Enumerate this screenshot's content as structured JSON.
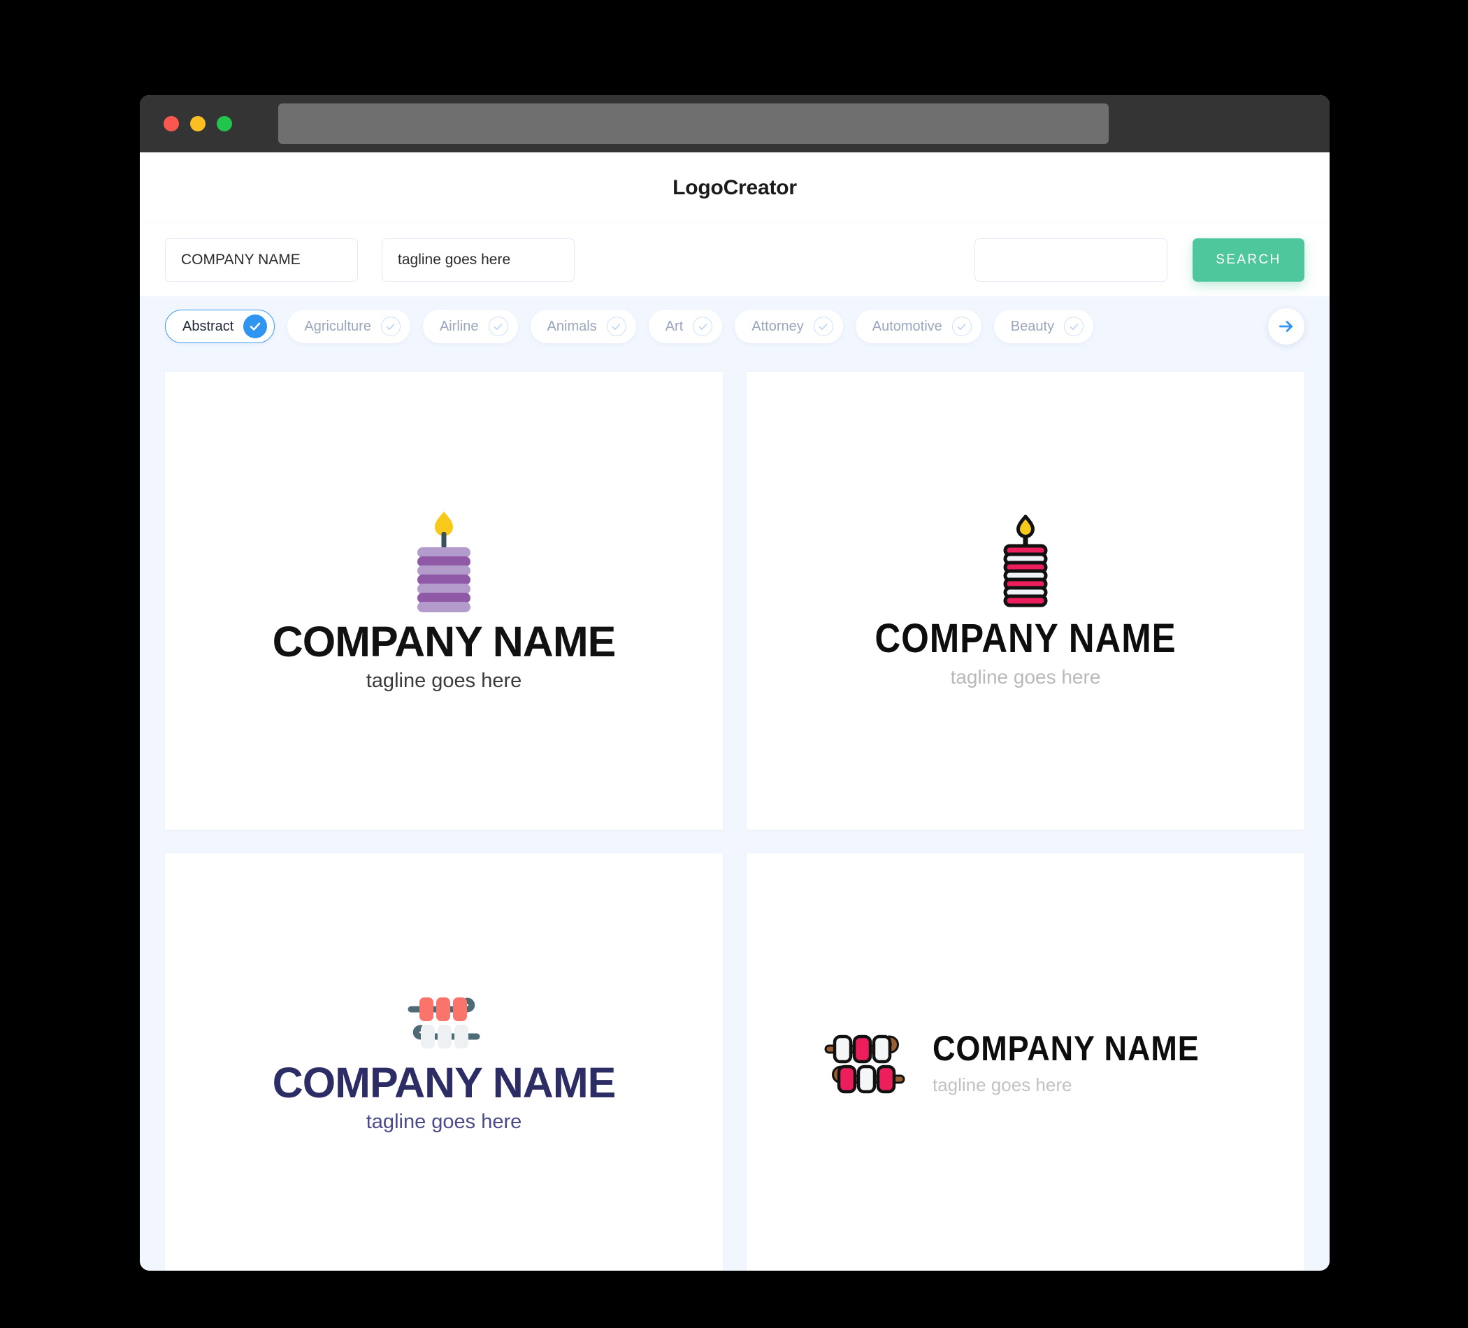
{
  "window": {
    "traffic_lights": [
      "close",
      "minimize",
      "maximize"
    ],
    "url_value": ""
  },
  "header": {
    "app_title": "LogoCreator"
  },
  "search": {
    "company_value": "COMPANY NAME",
    "company_placeholder": "COMPANY NAME",
    "tagline_value": "tagline goes here",
    "tagline_placeholder": "tagline goes here",
    "extra_value": "",
    "extra_placeholder": "",
    "search_label": "SEARCH",
    "search_color": "#4fc79c"
  },
  "chips": {
    "next_icon": "arrow-right-icon",
    "items": [
      {
        "label": "Abstract",
        "selected": true
      },
      {
        "label": "Agriculture",
        "selected": false
      },
      {
        "label": "Airline",
        "selected": false
      },
      {
        "label": "Animals",
        "selected": false
      },
      {
        "label": "Art",
        "selected": false
      },
      {
        "label": "Attorney",
        "selected": false
      },
      {
        "label": "Automotive",
        "selected": false
      },
      {
        "label": "Beauty",
        "selected": false
      }
    ]
  },
  "results": {
    "cards": [
      {
        "icon": "candle-stacked-discs-purple-icon",
        "title": "COMPANY NAME",
        "tagline": "tagline goes here",
        "title_color": "#111111",
        "tagline_color": "#3a3a3a"
      },
      {
        "icon": "candle-stacked-discs-crimson-outline-icon",
        "title": "COMPANY NAME",
        "tagline": "tagline goes here",
        "title_color": "#0d0d0d",
        "tagline_color": "#b9b9b9"
      },
      {
        "icon": "double-skewer-coral-gray-icon",
        "title": "COMPANY NAME",
        "tagline": "tagline goes here",
        "title_color": "#2d2d66",
        "tagline_color": "#4a4a8a"
      },
      {
        "icon": "double-skewer-crimson-outline-icon",
        "title": "COMPANY NAME",
        "tagline": "tagline goes here",
        "title_color": "#0d0d0d",
        "tagline_color": "#c2c2c2"
      }
    ]
  },
  "palette": {
    "page_bg": "#f2f6fe",
    "titlebar": "#343434",
    "accent_blue": "#2f95f0",
    "purple_light": "#b39ccc",
    "purple_dark": "#9059a8",
    "crimson": "#ec1e5c",
    "coral": "#f9756b",
    "slate": "#4e6b75",
    "brown": "#9a5f33",
    "flame_yellow": "#f6c91a"
  }
}
